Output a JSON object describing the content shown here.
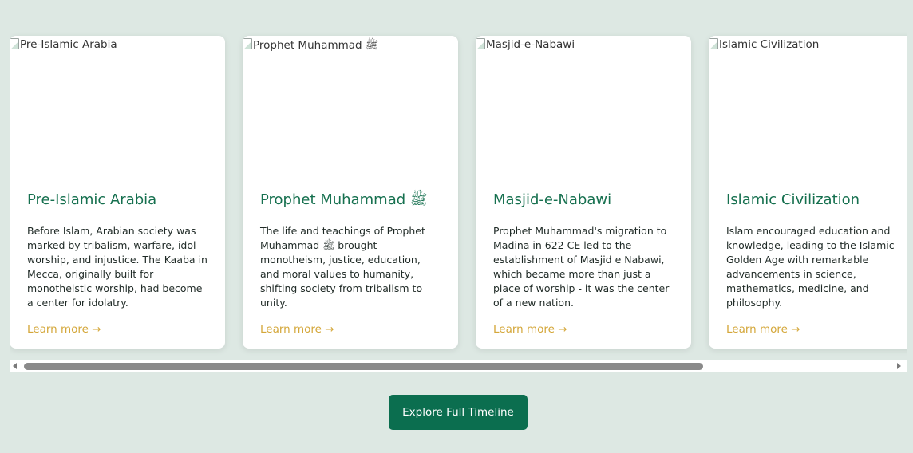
{
  "cards": [
    {
      "image_alt": "Pre-Islamic Arabia",
      "title": "Pre-Islamic Arabia",
      "text": "Before Islam, Arabian society was marked by tribalism, warfare, idol worship, and injustice. The Kaaba in Mecca, originally built for monotheistic worship, had become a center for idolatry.",
      "link": "Learn more →"
    },
    {
      "image_alt": "Prophet Muhammad ﷺ",
      "title": "Prophet Muhammad ﷺ",
      "text": "The life and teachings of Prophet Muhammad ﷺ brought monotheism, justice, education, and moral values to humanity, shifting society from tribalism to unity.",
      "link": "Learn more →"
    },
    {
      "image_alt": "Masjid-e-Nabawi",
      "title": "Masjid-e-Nabawi",
      "text": "Prophet Muhammad's migration to Madina in 622 CE led to the establishment of Masjid e Nabawi, which became more than just a place of worship - it was the center of a new nation.",
      "link": "Learn more →"
    },
    {
      "image_alt": "Islamic Civilization",
      "title": "Islamic Civilization",
      "text": "Islam encouraged education and knowledge, leading to the Islamic Golden Age with remarkable advancements in science, mathematics, medicine, and philosophy.",
      "link": "Learn more →"
    }
  ],
  "cta": {
    "label": "Explore Full Timeline"
  },
  "colors": {
    "page_background": "#f1f6f4",
    "title_green": "#16704f",
    "link_gold": "#d4a73a",
    "button_green": "#0b6e4f"
  },
  "icons": {
    "broken_image": "broken-image-icon",
    "arrow_left": "scroll-left-arrow-icon",
    "arrow_right": "scroll-right-arrow-icon"
  }
}
